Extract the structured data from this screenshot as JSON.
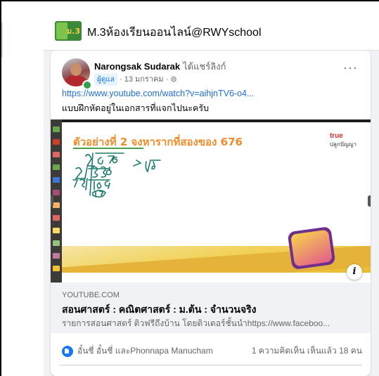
{
  "group": {
    "logo_text": "ม.3",
    "title": "M.3ห้องเรียนออนไลน์@RWYschool"
  },
  "post": {
    "author": "Narongsak Sudarak",
    "shared_text": "ได้แชร์ลิงก์",
    "admin_badge": "ผู้ดูแล",
    "date": "· 13 มกราคม ·",
    "more": "···",
    "link": "https://www.youtube.com/watch?v=aihjnTV6-o4...",
    "text": "แบบฝึกหัดอยู่ในเอกสารที่แจกไปนะครับ"
  },
  "video": {
    "title": "ตัวอย่างที่ 2  จงหารากที่สองของ 676",
    "brand": "true",
    "brand_sub": "ปลูกปัญญา",
    "info": "i"
  },
  "link_preview": {
    "domain": "YOUTUBE.COM",
    "title": "สอนศาสตร์ : คณิตศาสตร์ : ม.ต้น : จำนวนจริง",
    "description": "รายการสอนศาสตร์ ติวฟรีถึงบ้าน โดยติวเตอร์ชั้นนำhttps://www.faceboo..."
  },
  "reactions": {
    "reactors": "อั๋นชี่ อั๋นชี่ และPhonnapa Manucham",
    "counts": "1 ความคิดเห็น  เห็นแล้ว 18 คน"
  }
}
